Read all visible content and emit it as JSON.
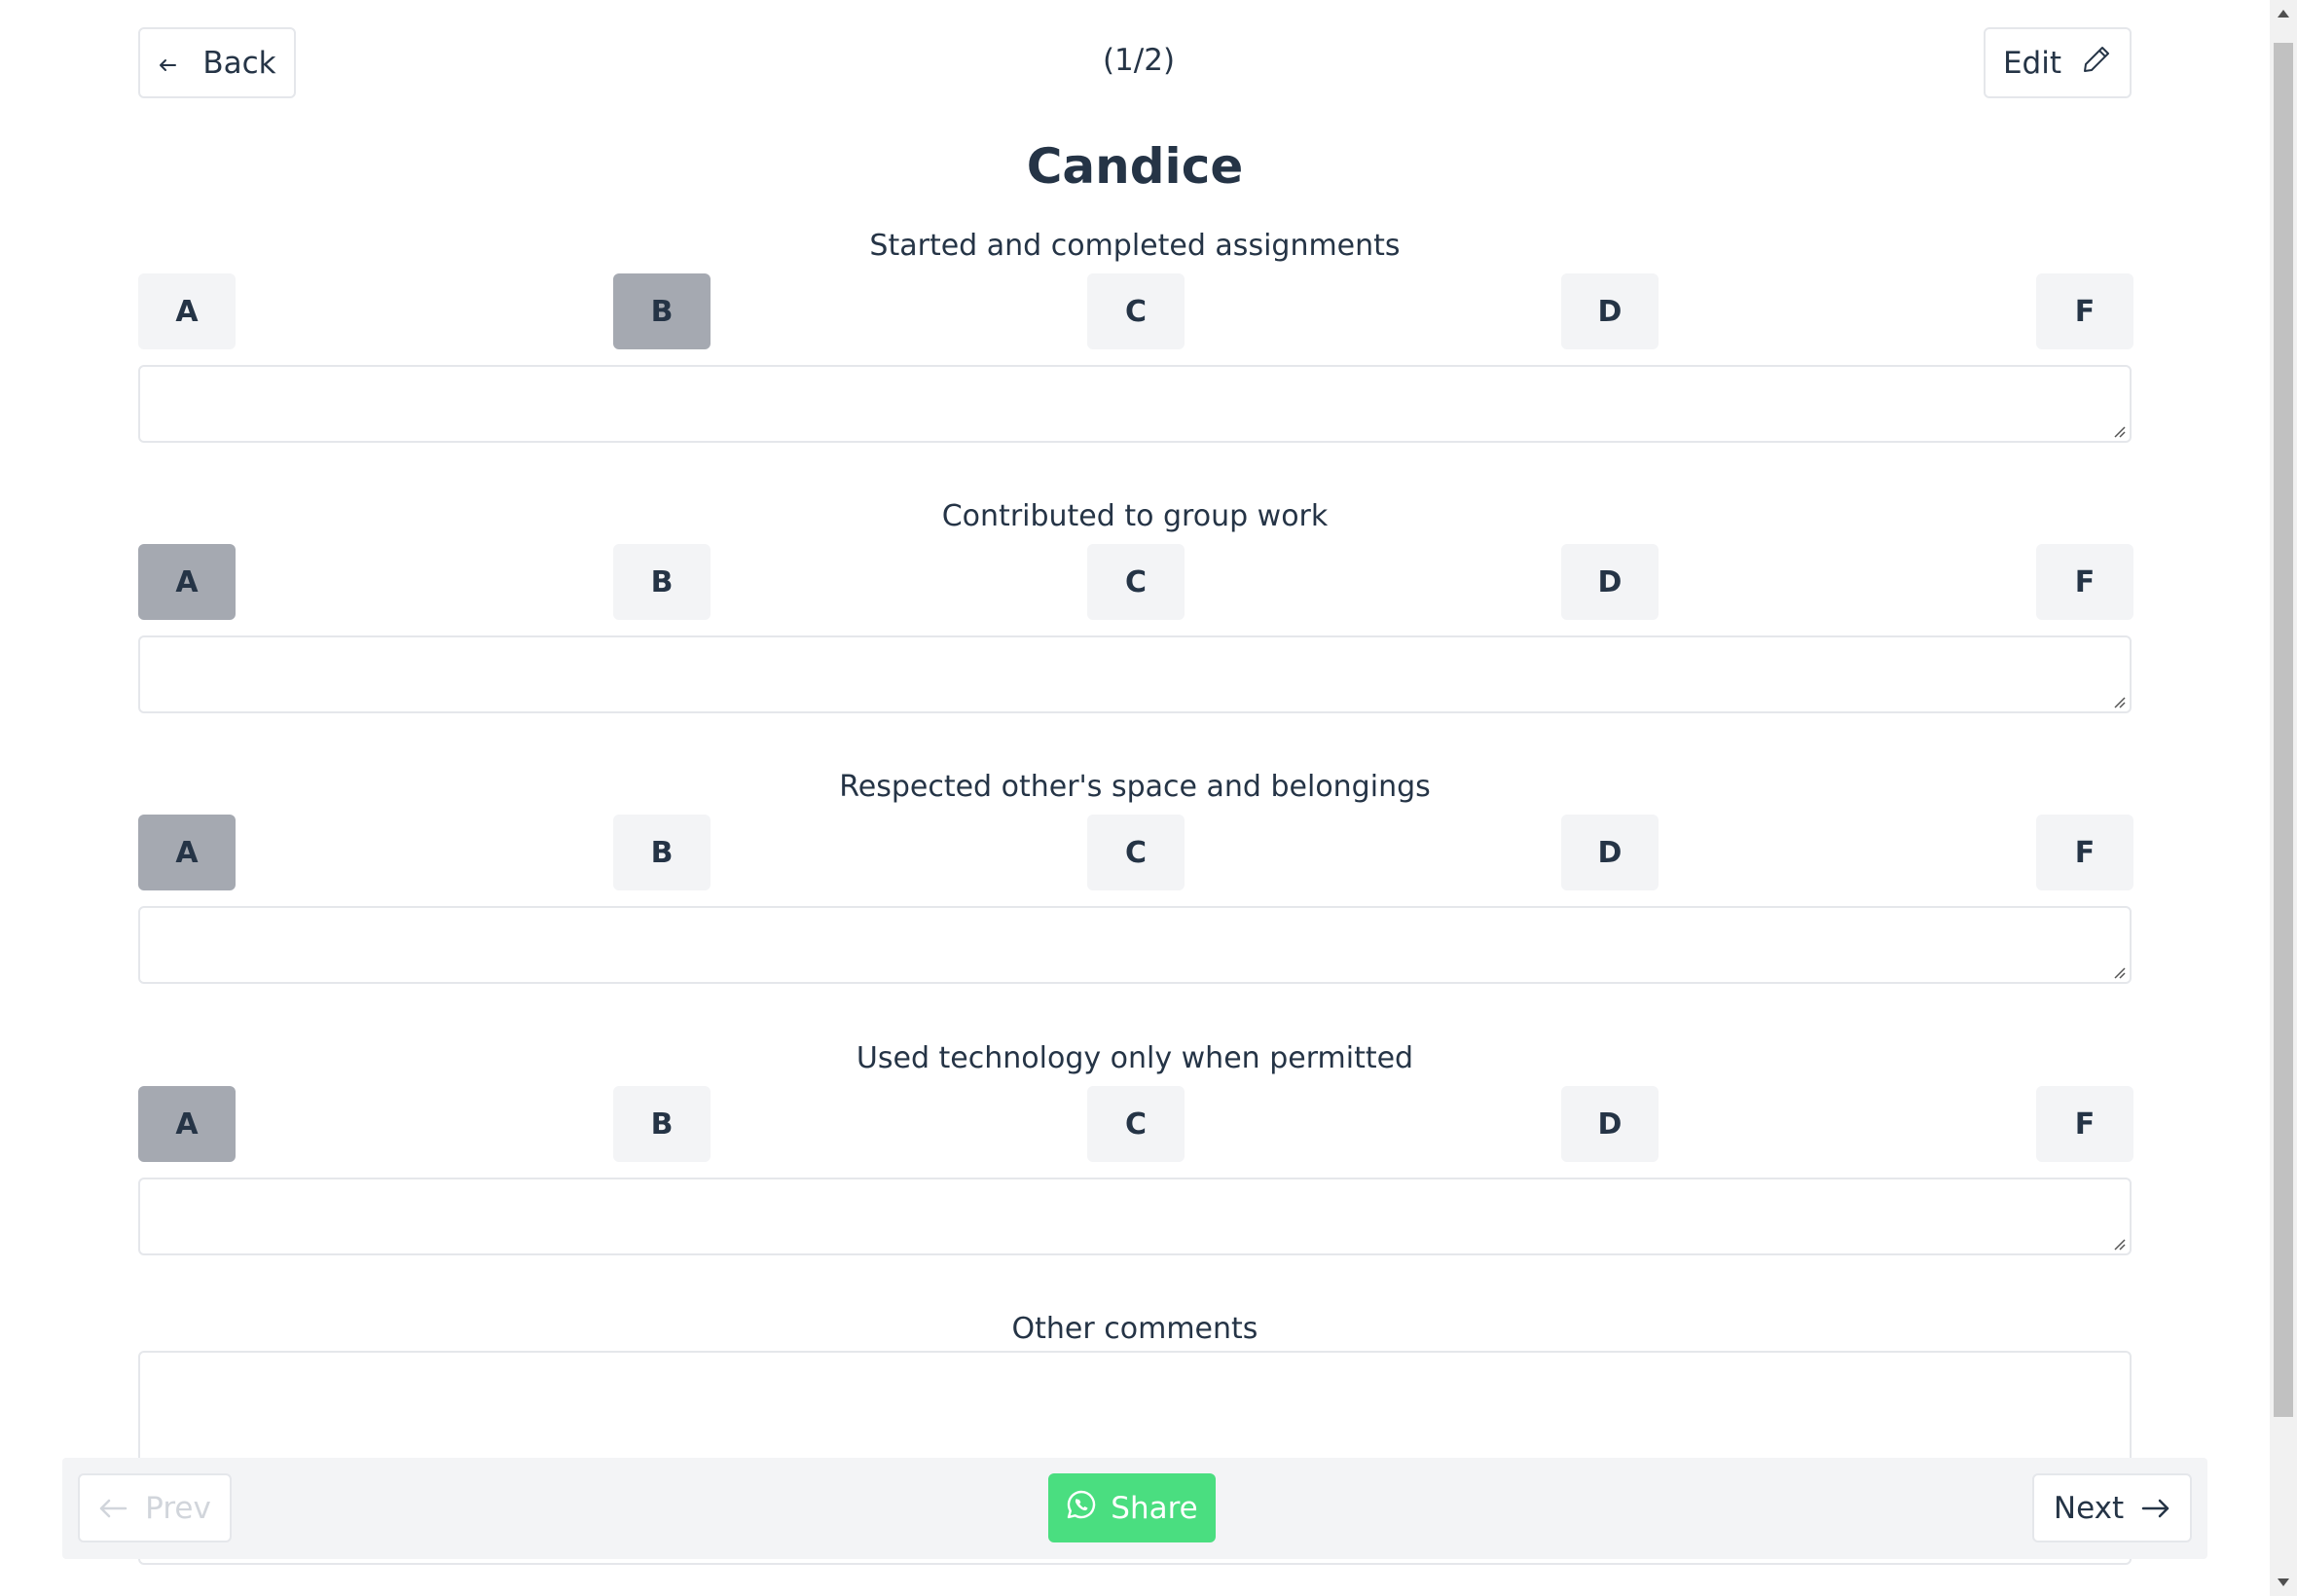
{
  "header": {
    "back_label": "Back",
    "counter": "(1/2)",
    "edit_label": "Edit"
  },
  "student_name": "Candice",
  "grade_options": [
    "A",
    "B",
    "C",
    "D",
    "F"
  ],
  "questions": [
    {
      "label": "Started and completed assignments",
      "selected_grade": "B",
      "comment": ""
    },
    {
      "label": "Contributed to group work",
      "selected_grade": "A",
      "comment": ""
    },
    {
      "label": "Respected other's space and belongings",
      "selected_grade": "A",
      "comment": ""
    },
    {
      "label": "Used technology only when permitted",
      "selected_grade": "A",
      "comment": ""
    }
  ],
  "other_comments": {
    "label": "Other comments",
    "value": ""
  },
  "footer": {
    "prev_label": "Prev",
    "share_label": "Share",
    "next_label": "Next"
  },
  "colors": {
    "text": "#253446",
    "selected_grade_bg": "#a5a9b1",
    "grade_bg": "#f3f4f6",
    "share_bg": "#4ade80"
  },
  "icons": {
    "back": "arrow-left-icon",
    "edit": "pencil-icon",
    "prev": "arrow-left-icon",
    "share": "whatsapp-icon",
    "next": "arrow-right-icon"
  }
}
